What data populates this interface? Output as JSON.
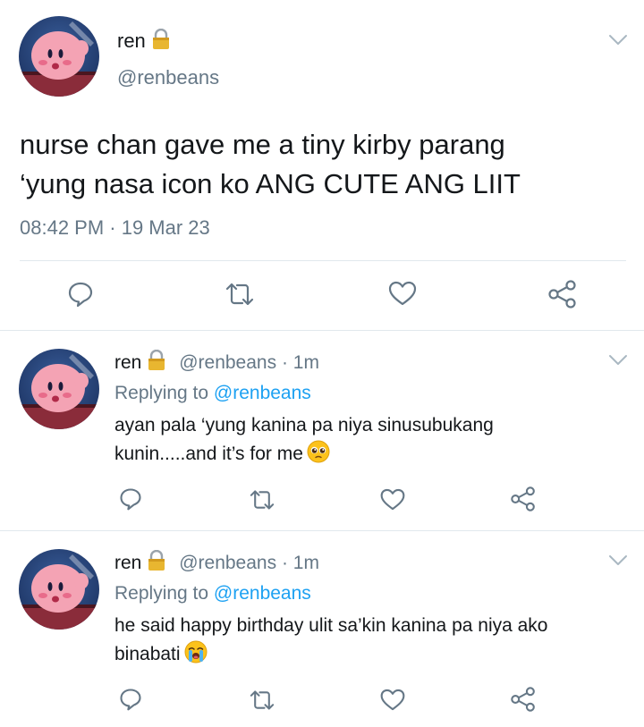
{
  "main_tweet": {
    "display_name": "ren",
    "handle": "@renbeans",
    "text_line1": "nurse chan gave me a tiny kirby parang",
    "text_line2": "‘yung nasa icon ko ANG CUTE ANG LIIT",
    "timestamp": "08:42 PM · 19 Mar 23"
  },
  "replies": [
    {
      "display_name": "ren",
      "handle": "@renbeans",
      "time": "· 1m",
      "replying_prefix": "Replying to",
      "replying_to": "@renbeans",
      "text_line1": "ayan pala ‘yung kanina pa niya sinusubukang",
      "text_line2": "kunin.....and it’s for me",
      "emoji": "pleading-face-emoji"
    },
    {
      "display_name": "ren",
      "handle": "@renbeans",
      "time": "· 1m",
      "replying_prefix": "Replying to",
      "replying_to": "@renbeans",
      "text_line1": "he said happy birthday ulit sa’kin kanina pa niya ako",
      "text_line2": "binabati",
      "emoji": "loudly-crying-face-emoji"
    }
  ],
  "actions": [
    "reply-icon",
    "retweet-icon",
    "like-icon",
    "share-icon"
  ],
  "colors": {
    "text": "#14171a",
    "secondary": "#657786",
    "link": "#1da1f2",
    "divider": "#e1e8ed",
    "lock": "#e8b630"
  }
}
